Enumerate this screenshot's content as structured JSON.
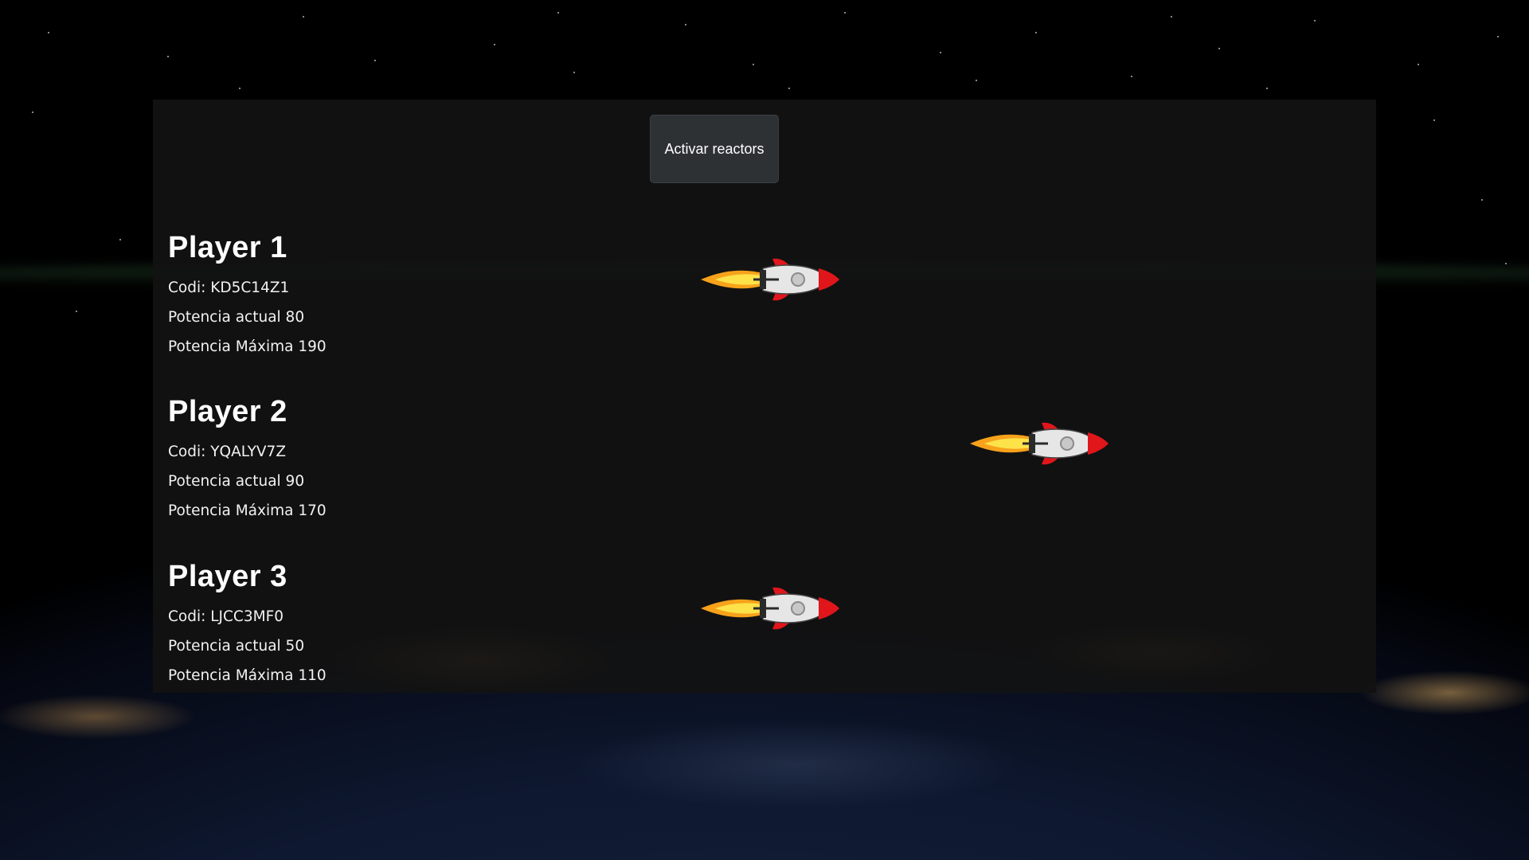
{
  "controls": {
    "activate_label": "Activar reactors"
  },
  "players": [
    {
      "name": "Player 1",
      "code_line": "Codi: KD5C14Z1",
      "current_line": "Potencia actual 80",
      "max_line": "Potencia Máxima 190",
      "rocket_icon": "rocket-icon"
    },
    {
      "name": "Player 2",
      "code_line": "Codi: YQALYV7Z",
      "current_line": "Potencia actual 90",
      "max_line": "Potencia Máxima 170",
      "rocket_icon": "rocket-icon"
    },
    {
      "name": "Player 3",
      "code_line": "Codi: LJCC3MF0",
      "current_line": "Potencia actual 50",
      "max_line": "Potencia Máxima 110",
      "rocket_icon": "rocket-icon"
    }
  ],
  "colors": {
    "panel": "#121212",
    "button": "#2e3134",
    "text": "#ffffff",
    "rocket_nose": "#e0161b",
    "rocket_body": "#e6e6e6",
    "flame": "#f7a21b"
  }
}
